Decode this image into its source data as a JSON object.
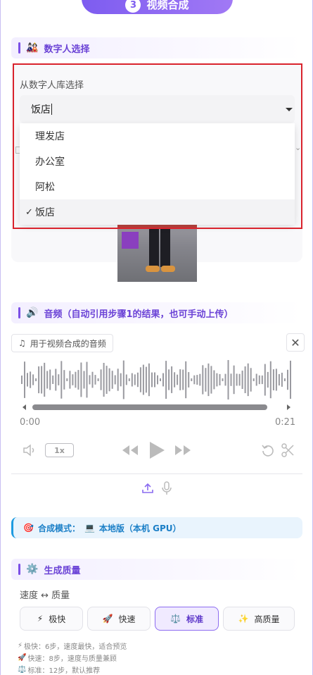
{
  "step": {
    "number": "3",
    "title": "视频合成"
  },
  "avatar_section": {
    "icon": "🎎",
    "title": "数字人选择",
    "picker_label": "从数字人库选择",
    "select_value": "饭店",
    "options": [
      {
        "label": "理发店",
        "selected": false
      },
      {
        "label": "办公室",
        "selected": false
      },
      {
        "label": "阿松",
        "selected": false
      },
      {
        "label": "饭店",
        "selected": true
      }
    ],
    "check_mark": "✓"
  },
  "audio_section": {
    "icon": "🔊",
    "title": "音频（自动引用步骤1的结果，也可手动上传）",
    "tag_icon": "♫",
    "tag_label": "用于视频合成的音频",
    "close_icon": "✕",
    "time_start": "0:00",
    "time_end": "0:21",
    "speed": "1x"
  },
  "mode_banner": {
    "icon": "🎯",
    "label": "合成模式：",
    "device_icon": "💻",
    "value": "本地版（本机 GPU）"
  },
  "quality_section": {
    "icon": "⚙️",
    "title": "生成质量",
    "speed_label": "速度 ↔ 质量",
    "options": [
      {
        "icon": "⚡",
        "label": "极快",
        "active": false
      },
      {
        "icon": "🚀",
        "label": "快速",
        "active": false
      },
      {
        "icon": "⚖️",
        "label": "标准",
        "active": true
      },
      {
        "icon": "✨",
        "label": "高质量",
        "active": false
      }
    ],
    "notes": [
      {
        "icon": "⚡",
        "text": "极快：6步，速度最快，适合预览"
      },
      {
        "icon": "🚀",
        "text": "快速：8步，速度与质量兼顾"
      },
      {
        "icon": "⚖️",
        "text": "标准：12步，默认推荐"
      }
    ]
  },
  "colors": {
    "accent": "#7b4fe6",
    "alert": "#d9232d",
    "info": "#1e9be0"
  }
}
